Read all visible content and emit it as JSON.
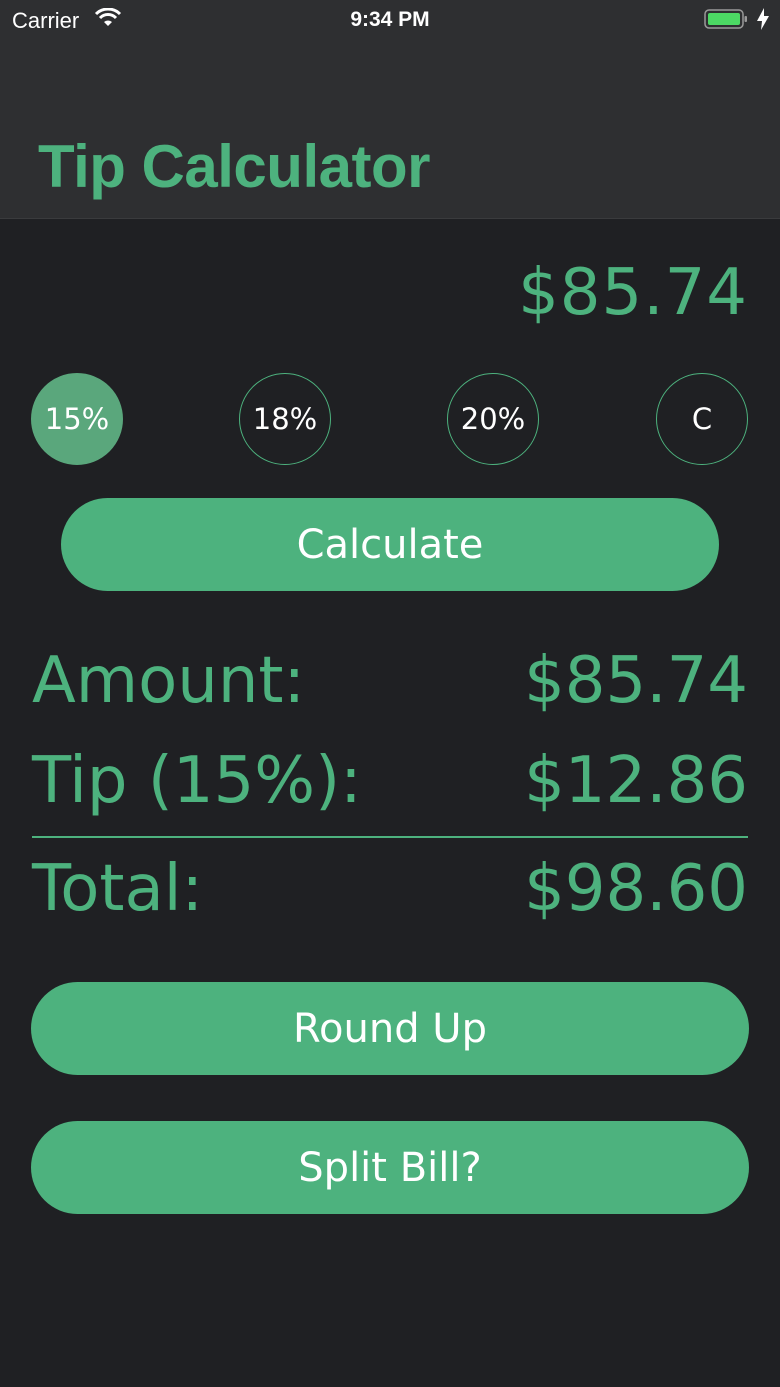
{
  "status_bar": {
    "carrier": "Carrier",
    "time": "9:34 PM"
  },
  "header": {
    "title": "Tip Calculator"
  },
  "input": {
    "amount": "$85.74"
  },
  "tip_options": [
    {
      "label": "15%",
      "selected": true
    },
    {
      "label": "18%",
      "selected": false
    },
    {
      "label": "20%",
      "selected": false
    },
    {
      "label": "C",
      "selected": false
    }
  ],
  "buttons": {
    "calculate": "Calculate",
    "round_up": "Round Up",
    "split_bill": "Split Bill?"
  },
  "results": {
    "amount_label": "Amount:",
    "amount_value": "$85.74",
    "tip_label": "Tip (15%):",
    "tip_value": "$12.86",
    "total_label": "Total:",
    "total_value": "$98.60"
  },
  "colors": {
    "accent": "#4db27e",
    "background": "#1f2023",
    "header": "#2e2f31"
  }
}
